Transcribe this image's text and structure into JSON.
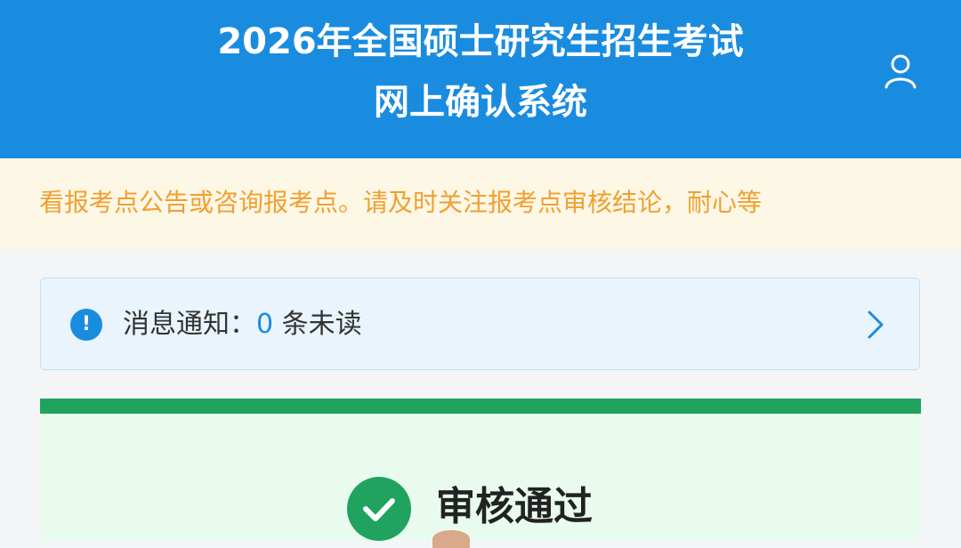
{
  "header": {
    "title_line1": "2026年全国硕士研究生招生考试",
    "title_line2": "网上确认系统",
    "user_icon": "user-icon",
    "bg_color": "#1a8ce0"
  },
  "banner": {
    "text": "看报考点公告或咨询报考点。请及时关注报考点审核结论，耐心等",
    "text_color": "#f0a030"
  },
  "notice": {
    "icon": "info-icon",
    "label": "消息通知：",
    "count": "0",
    "suffix": " 条未读",
    "arrow_icon": "chevron-right-icon"
  },
  "result": {
    "icon": "check-icon",
    "title": "审核通过",
    "status_color": "#1fa35e"
  }
}
